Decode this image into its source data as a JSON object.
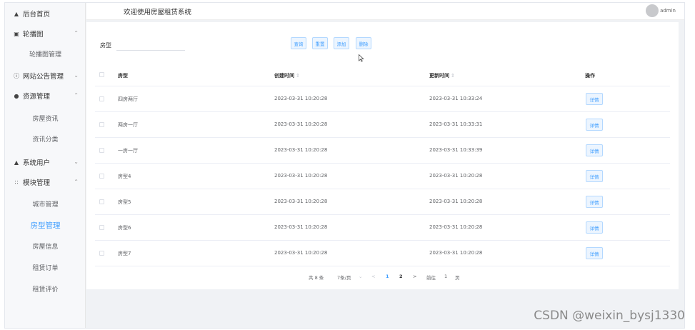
{
  "sidebar": {
    "items": [
      {
        "label": "后台首页",
        "icon": "home-icon"
      },
      {
        "label": "轮播图",
        "icon": "picture-icon",
        "expanded": true
      },
      {
        "label": "轮播图管理",
        "sub": true
      },
      {
        "label": "网站公告管理",
        "icon": "info-circle-icon",
        "expanded": false
      },
      {
        "label": "资源管理",
        "icon": "location-pin-icon",
        "expanded": true
      },
      {
        "label": "房屋资讯",
        "sub": true
      },
      {
        "label": "资讯分类",
        "sub": true
      },
      {
        "label": "系统用户",
        "icon": "user-icon",
        "expanded": false
      },
      {
        "label": "模块管理",
        "icon": "grid-icon",
        "expanded": true
      },
      {
        "label": "城市管理",
        "sub": true
      },
      {
        "label": "房型管理",
        "sub": true,
        "active": true
      },
      {
        "label": "房屋信息",
        "sub": true
      },
      {
        "label": "租赁订单",
        "sub": true
      },
      {
        "label": "租赁评价",
        "sub": true
      }
    ]
  },
  "header": {
    "title": "欢迎使用房屋租赁系统",
    "user": "admin"
  },
  "search": {
    "label": "房型",
    "value": "",
    "placeholder": ""
  },
  "toolbar": {
    "query": "查询",
    "reset": "重置",
    "add": "添加",
    "delete": "删除"
  },
  "table": {
    "columns": [
      "房型",
      "创建时间",
      "更新时间",
      "操作"
    ],
    "sort_mark": "⇕",
    "action_label": "详情",
    "rows": [
      {
        "name": "四房两厅",
        "created": "2023-03-31 10:20:28",
        "updated": "2023-03-31 10:33:24"
      },
      {
        "name": "两房一厅",
        "created": "2023-03-31 10:20:28",
        "updated": "2023-03-31 10:33:31"
      },
      {
        "name": "一房一厅",
        "created": "2023-03-31 10:20:28",
        "updated": "2023-03-31 10:33:39"
      },
      {
        "name": "房型4",
        "created": "2023-03-31 10:20:28",
        "updated": "2023-03-31 10:20:28"
      },
      {
        "name": "房型5",
        "created": "2023-03-31 10:20:28",
        "updated": "2023-03-31 10:20:28"
      },
      {
        "name": "房型6",
        "created": "2023-03-31 10:20:28",
        "updated": "2023-03-31 10:20:28"
      },
      {
        "name": "房型7",
        "created": "2023-03-31 10:20:28",
        "updated": "2023-03-31 10:20:28"
      }
    ]
  },
  "pagination": {
    "total": "共 8 条",
    "page_size": "7条/页",
    "size_arrow": "⌄",
    "prev": "<",
    "page1": "1",
    "page2": "2",
    "next": ">",
    "goto_label": "前往",
    "goto_value": "1",
    "page_unit": "页"
  },
  "watermark": "CSDN @weixin_bysj1330",
  "colors": {
    "accent": "#409eff",
    "sidebar_bg": "#f7f8fa",
    "page_bg": "#f0f2f5"
  }
}
